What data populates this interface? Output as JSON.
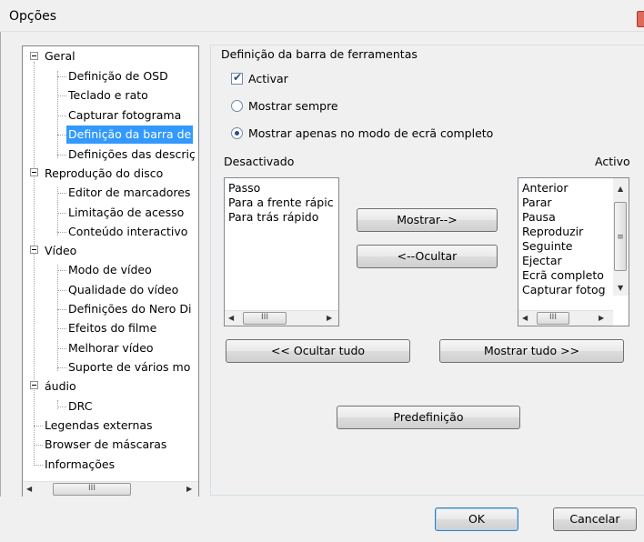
{
  "window": {
    "title": "Opções"
  },
  "tree": {
    "items": [
      {
        "label": "Geral"
      },
      {
        "label": "Definição de OSD"
      },
      {
        "label": "Teclado e rato"
      },
      {
        "label": "Capturar fotograma"
      },
      {
        "label": "Definição da barra de"
      },
      {
        "label": "Definições das descriç"
      },
      {
        "label": "Reprodução do disco"
      },
      {
        "label": "Editor de marcadores"
      },
      {
        "label": "Limitação de acesso"
      },
      {
        "label": "Conteúdo interactivo"
      },
      {
        "label": "Vídeo"
      },
      {
        "label": "Modo de vídeo"
      },
      {
        "label": "Qualidade do vídeo"
      },
      {
        "label": "Definições do Nero Di"
      },
      {
        "label": "Efeitos do filme"
      },
      {
        "label": "Melhorar vídeo"
      },
      {
        "label": "Suporte de vários mo"
      },
      {
        "label": "áudio"
      },
      {
        "label": "DRC"
      },
      {
        "label": "Legendas externas"
      },
      {
        "label": "Browser de máscaras"
      },
      {
        "label": "Informações"
      }
    ],
    "selected_index": 4,
    "scroll_thumb_glyph": "III"
  },
  "toolbar_settings": {
    "group_title": "Definição da barra de ferramentas",
    "activate_label": "Activar",
    "activate_checked": true,
    "show_always_label": "Mostrar sempre",
    "show_fullscreen_label": "Mostrar apenas no modo de ecrã completo",
    "selected_mode": "fullscreen"
  },
  "lists": {
    "disabled_title": "Desactivado",
    "active_title": "Activo",
    "disabled_items": [
      "Passo",
      "Para a frente rápic",
      "Para trás rápido"
    ],
    "active_items": [
      "Anterior",
      "Parar",
      "Pausa",
      "Reproduzir",
      "Seguinte",
      "Ejectar",
      "Ecrã completo",
      "Capturar fotog"
    ],
    "scroll_thumb_glyph": "III",
    "vscroll_thumb_glyph": "≡"
  },
  "buttons": {
    "show": "Mostrar-->",
    "hide": "<--Ocultar",
    "hide_all": "<< Ocultar tudo",
    "show_all": "Mostrar tudo >>",
    "default": "Predefinição",
    "ok": "OK",
    "cancel": "Cancelar"
  }
}
